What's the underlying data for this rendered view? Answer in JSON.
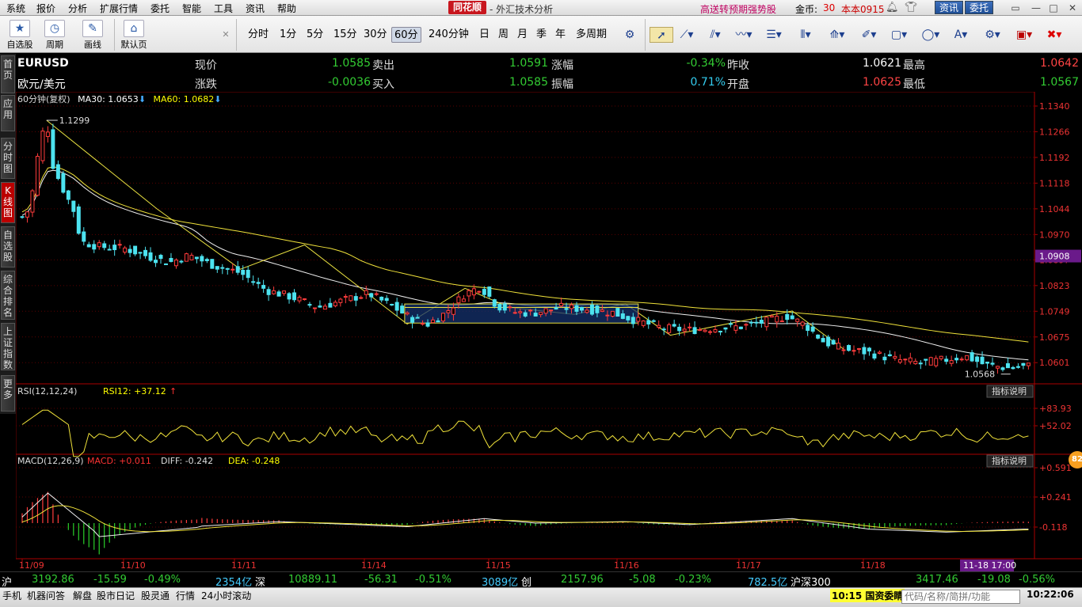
{
  "menu": [
    "系统",
    "报价",
    "分析",
    "扩展行情",
    "委托",
    "智能",
    "工具",
    "资讯",
    "帮助"
  ],
  "brand": "同花顺",
  "app_title": "- 外汇技术分析",
  "promo": "高送转预期强势股",
  "coin_label": "金币:",
  "coin_value": "30",
  "version": "本本0915",
  "top_buttons": {
    "news": "资讯",
    "trade": "委托"
  },
  "toolbar": {
    "big": [
      "自选股",
      "周期",
      "画线",
      "默认页"
    ],
    "periods": [
      "分时",
      "1分",
      "5分",
      "15分",
      "30分",
      "60分",
      "240分钟",
      "日",
      "周",
      "月",
      "季",
      "年",
      "多周期"
    ],
    "active_period": "60分"
  },
  "sidebar": [
    "首页",
    "应用",
    "分时图",
    "K线图",
    "自选股",
    "综合排名",
    "上证指数",
    "更多"
  ],
  "quote": {
    "symbol": "EURUSD",
    "name": "欧元/美元",
    "labels": {
      "now": "现价",
      "chg": "涨跌",
      "sell": "卖出",
      "buy": "买入",
      "pct": "涨幅",
      "amp": "振幅",
      "prev": "昨收",
      "open": "开盘",
      "high": "最高",
      "low": "最低"
    },
    "now": "1.0585",
    "chg": "-0.0036",
    "sell": "1.0591",
    "buy": "1.0585",
    "pct": "-0.34%",
    "amp": "0.71%",
    "prev": "1.0621",
    "open": "1.0625",
    "high": "1.0642",
    "low": "1.0567"
  },
  "indicator_line": {
    "period": "60分钟(复权)",
    "ma30": "MA30: 1.0653",
    "ma60": "MA60: 1.0682"
  },
  "chart_data": {
    "type": "candlestick",
    "price_axis": [
      "1.1340",
      "1.1266",
      "1.1192",
      "1.1118",
      "1.1044",
      "1.0970",
      "1.0897",
      "1.0823",
      "1.0749",
      "1.0675",
      "1.0601"
    ],
    "price_axis_highlight": "1.0908",
    "ylim": [
      1.054,
      1.134
    ],
    "high_label": "1.1299",
    "low_label": "1.0568",
    "dates": [
      "11/09",
      "11/10",
      "11/11",
      "11/14",
      "11/15",
      "11/16",
      "11/17",
      "11/18"
    ],
    "cursor_time": "11-18 17:00",
    "rsi": {
      "title": "RSI(12,12,24)",
      "value": "RSI12: +37.12",
      "axis": [
        "+83.93",
        "+52.02"
      ],
      "help": "指标说明"
    },
    "macd": {
      "title": "MACD(12,26,9)",
      "macd": "MACD: +0.011",
      "diff": "DIFF: -0.242",
      "dea": "DEA: -0.248",
      "axis": [
        "+0.591",
        "+0.241",
        "-0.118"
      ],
      "help": "指标说明"
    }
  },
  "status": [
    {
      "name": "沪",
      "price": "3192.86",
      "chg": "-15.59",
      "pct": "-0.49%",
      "vol": "2354亿"
    },
    {
      "name": "深",
      "price": "10889.11",
      "chg": "-56.31",
      "pct": "-0.51%",
      "vol": "3089亿"
    },
    {
      "name": "创",
      "price": "2157.96",
      "chg": "-5.08",
      "pct": "-0.23%",
      "vol": "782.5亿"
    },
    {
      "name": "沪深300",
      "price": "3417.46",
      "chg": "-19.08",
      "pct": "-0.56%",
      "vol": ""
    }
  ],
  "taskbar": [
    "手机",
    "机器问答",
    "解盘",
    "股市日记",
    "股灵通",
    "行情",
    "24小时滚动"
  ],
  "ticker": "10:15 国资委睛",
  "search_placeholder": "代码/名称/简拼/功能",
  "clock": "10:22:06",
  "badge": "82"
}
